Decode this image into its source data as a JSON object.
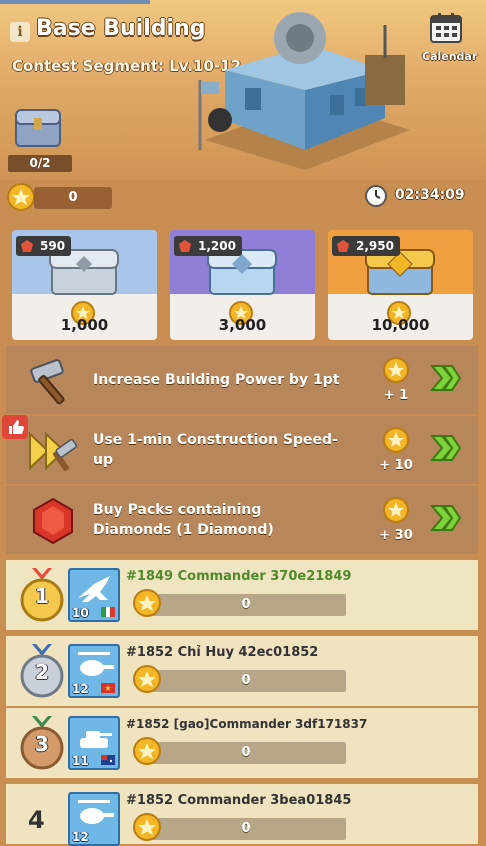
{
  "header": {
    "title": "Base Building",
    "info_icon": "i",
    "segment": "Contest Segment: Lv.10-12",
    "calendar_label": "Calendar",
    "chest_count": "0/2"
  },
  "status": {
    "points": "0",
    "timer": "02:34:09"
  },
  "chests": [
    {
      "cost": "590",
      "price": "1,000",
      "tier": "silver"
    },
    {
      "cost": "1,200",
      "price": "3,000",
      "tier": "purple"
    },
    {
      "cost": "2,950",
      "price": "10,000",
      "tier": "gold"
    }
  ],
  "tasks": [
    {
      "label": "Increase Building Power by 1pt",
      "reward": "+ 1",
      "icon": "hammer-icon"
    },
    {
      "label": "Use 1-min Construction Speed-up",
      "reward": "+ 10",
      "icon": "speed-up-icon"
    },
    {
      "label": "Buy Packs containing Diamonds (1 Diamond)",
      "reward": "+ 30",
      "icon": "diamond-icon"
    }
  ],
  "leaderboard": [
    {
      "rank": "1",
      "name": "#1849 Commander 370e21849",
      "level": "10",
      "score": "0",
      "unit": "plane-icon",
      "flag": "italy-flag"
    },
    {
      "rank": "2",
      "name": "#1852 Chỉ Huy 42ec01852",
      "level": "12",
      "score": "0",
      "unit": "helicopter-icon",
      "flag": "vietnam-flag"
    },
    {
      "rank": "3",
      "name": "#1852 [gao]Commander 3df171837",
      "level": "11",
      "score": "0",
      "unit": "tank-icon",
      "flag": "australia-flag"
    },
    {
      "rank": "4",
      "name": "#1852 Commander 3bea01845",
      "level": "12",
      "score": "0",
      "unit": "helicopter-icon",
      "flag": ""
    }
  ],
  "colors": {
    "accent_green": "#4f8a2b",
    "coin_gold": "#f2b626",
    "task_bg": "#b7865a"
  }
}
